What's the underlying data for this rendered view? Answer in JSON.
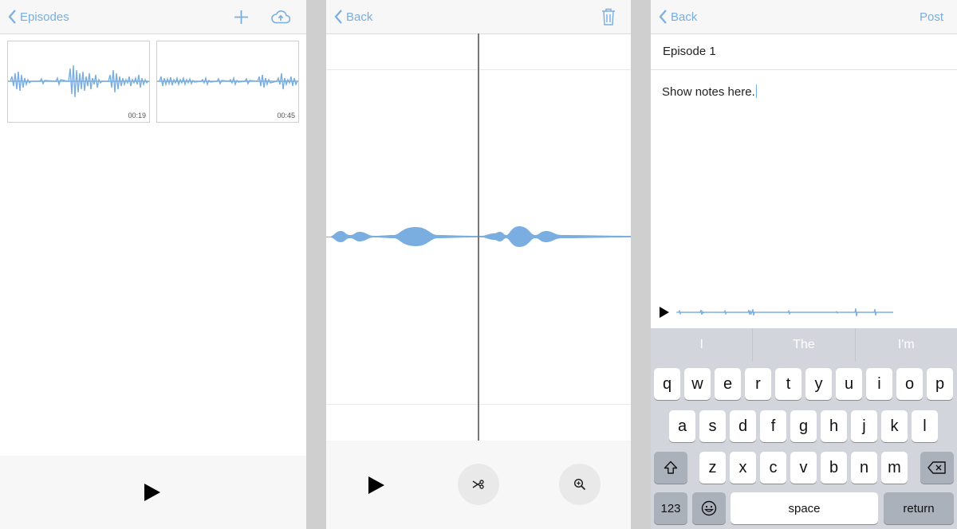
{
  "screen1": {
    "back_label": "Episodes",
    "add_icon": "plus-icon",
    "upload_icon": "cloud-upload-icon",
    "recordings": [
      {
        "duration": "00:19"
      },
      {
        "duration": "00:45"
      }
    ],
    "play_icon": "play-icon"
  },
  "screen2": {
    "back_label": "Back",
    "trash_icon": "trash-icon",
    "play_icon": "play-icon",
    "cut_icon": "scissors-icon",
    "zoom_icon": "zoom-in-icon"
  },
  "screen3": {
    "back_label": "Back",
    "post_label": "Post",
    "title_value": "Episode 1",
    "notes_value": "Show notes here.",
    "keyboard": {
      "predictions": [
        "I",
        "The",
        "I'm"
      ],
      "row1": [
        "q",
        "w",
        "e",
        "r",
        "t",
        "y",
        "u",
        "i",
        "o",
        "p"
      ],
      "row2": [
        "a",
        "s",
        "d",
        "f",
        "g",
        "h",
        "j",
        "k",
        "l"
      ],
      "row3": [
        "z",
        "x",
        "c",
        "v",
        "b",
        "n",
        "m"
      ],
      "numbers_label": "123",
      "space_label": "space",
      "return_label": "return"
    }
  },
  "colors": {
    "accent": "#7aaee0",
    "waveform": "#7aaee0"
  }
}
